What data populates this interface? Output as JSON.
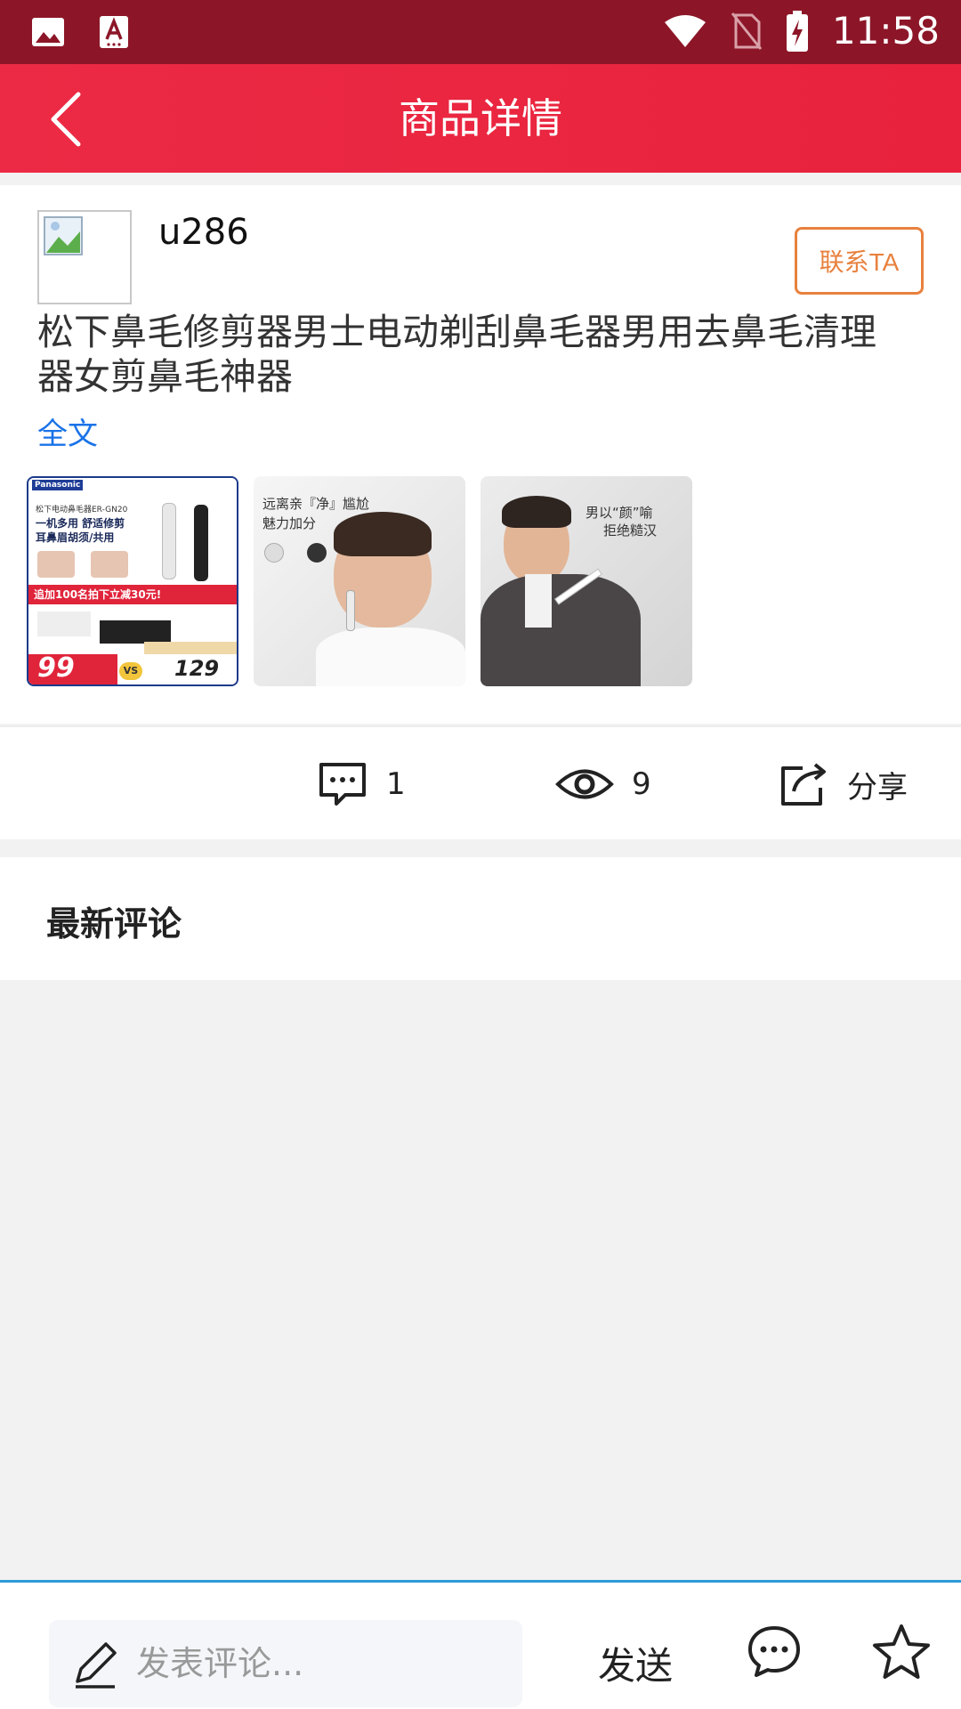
{
  "status_bar": {
    "time": "11:58"
  },
  "app_bar": {
    "title": "商品详情"
  },
  "post": {
    "username": "u286",
    "contact_label": "联系TA",
    "text": "松下鼻毛修剪器男士电动剃刮鼻毛器男用去鼻毛清理器女剪鼻毛神器",
    "full_text_link": "全文",
    "images": [
      {
        "brand": "Panasonic",
        "model": "松下电动鼻毛器ER-GN20",
        "headline_1": "一机多用 舒适修剪",
        "headline_2": "耳鼻眉胡须/共用",
        "promo": "追加100名拍下立减30元!",
        "price_left": "99",
        "price_right": "129",
        "vs": "VS"
      },
      {
        "caption_1": "远离亲『净』尴尬",
        "caption_2": "魅力加分"
      },
      {
        "caption_1": "男以“颜”喻",
        "caption_2": "拒绝糙汉"
      }
    ]
  },
  "stats": {
    "comments": "1",
    "views": "9",
    "share_label": "分享"
  },
  "comments_section": {
    "title": "最新评论"
  },
  "bottom_bar": {
    "placeholder": "发表评论...",
    "send_label": "发送"
  },
  "colors": {
    "app_bar": "#e8223c",
    "status_bar": "#8c1628",
    "contact": "#e8813e",
    "link": "#1a73e8",
    "divider_accent": "#2d9ad6"
  }
}
